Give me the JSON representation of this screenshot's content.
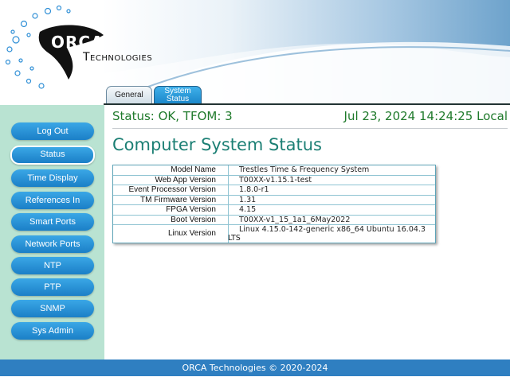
{
  "brand": {
    "name": "ORCA",
    "tagline": "Technologies"
  },
  "tabs": [
    {
      "label": "General"
    },
    {
      "label": "System Status",
      "line1": "System",
      "line2": "Status",
      "active": true
    }
  ],
  "sidebar": {
    "items": [
      {
        "label": "Log Out"
      },
      {
        "label": "Status",
        "active": true
      },
      {
        "label": "Time Display"
      },
      {
        "label": "References In"
      },
      {
        "label": "Smart Ports"
      },
      {
        "label": "Network Ports"
      },
      {
        "label": "NTP"
      },
      {
        "label": "PTP"
      },
      {
        "label": "SNMP"
      },
      {
        "label": "Sys Admin"
      }
    ]
  },
  "status": {
    "summary": "Status: OK, TFOM: 3",
    "datetime": "Jul 23, 2024 14:24:25 Local"
  },
  "main": {
    "title": "Computer System Status",
    "rows": [
      {
        "label": "Model Name",
        "value": "Trestles Time & Frequency System"
      },
      {
        "label": "Web App Version",
        "value": "T00XX-v1.15.1-test"
      },
      {
        "label": "Event Processor Version",
        "value": "1.8.0-r1"
      },
      {
        "label": "TM Firmware Version",
        "value": "1.31"
      },
      {
        "label": "FPGA Version",
        "value": "4.15"
      },
      {
        "label": "Boot Version",
        "value": "T00XX-v1_15_1a1_6May2022"
      },
      {
        "label": "Linux Version",
        "value": "Linux 4.15.0-142-generic x86_64 Ubuntu 16.04.3 LTS"
      }
    ]
  },
  "footer": {
    "text": "ORCA Technologies © 2020-2024"
  },
  "colors": {
    "accent": "#1b7fc7",
    "status_green": "#1f7a2b",
    "sidebar_bg": "#b9e3d2",
    "footer_bg": "#2f7fc1"
  }
}
